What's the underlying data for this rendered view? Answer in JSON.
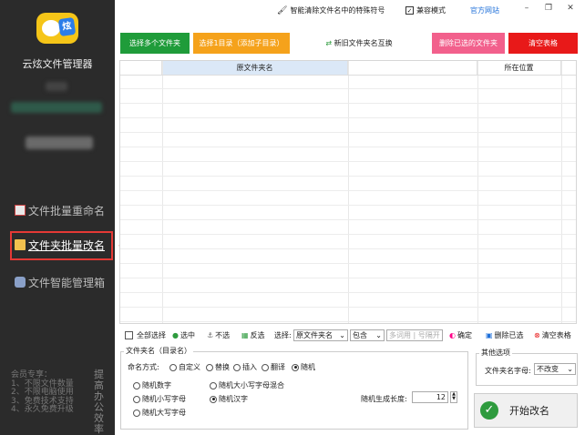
{
  "app": {
    "name": "云炫文件管理器"
  },
  "sidebar": {
    "items": [
      {
        "label": "文件批量重命名"
      },
      {
        "label": "文件夹批量改名"
      },
      {
        "label": "文件智能管理箱"
      }
    ],
    "member_lines": [
      "会员专享：",
      "1、不限文件数量",
      "2、不限电脑使用",
      "3、免费技术支持",
      "4、永久免费升级"
    ],
    "slogan": "提高办公效率"
  },
  "titlebar": {
    "special_chars_label": "智能清除文件名中的特殊符号",
    "compat_label": "兼容模式",
    "compat_checked": "✓",
    "website_label": "官方网站",
    "min_icon": "–",
    "restore_icon": "❐",
    "close_icon": "✕"
  },
  "toolbar": {
    "select_folders": "选择多个文件夹",
    "select_subdir": "选择1目录（添加子目录）",
    "swap_names": "新旧文件夹名互换",
    "delete_selected": "删除已选的文件夹",
    "clear_table": "清空表格"
  },
  "table": {
    "columns": [
      "原文件夹名",
      "所在位置"
    ]
  },
  "selbar": {
    "select_all": "全部选择",
    "select": "选中",
    "unselect": "不选",
    "invert": "反选",
    "choose_label": "选择:",
    "field_select": "原文件夹名",
    "mode_select": "包含",
    "input_placeholder": "多词用 | 号隔开",
    "confirm": "确定",
    "delete_selected": "删除已选",
    "clear_table": "清空表格"
  },
  "options": {
    "group_title": "文件夹名（目录名）",
    "naming_label": "命名方式:",
    "naming_modes": [
      "自定义",
      "替换",
      "插入",
      "翻译",
      "随机"
    ],
    "random_opts": [
      "随机数字",
      "随机大小写字母混合",
      "随机小写字母",
      "随机汉字",
      "随机大写字母"
    ],
    "length_label": "随机生成长度:",
    "length_value": "12"
  },
  "other": {
    "group_title": "其他选项",
    "case_label": "文件夹名字母:",
    "case_value": "不改变"
  },
  "start_button": "开始改名",
  "colors": {
    "green": "#1f9c3a",
    "orange": "#f5a21b",
    "pink": "#f2608c",
    "red": "#e81919",
    "header_blue": "#dbe8f7"
  }
}
